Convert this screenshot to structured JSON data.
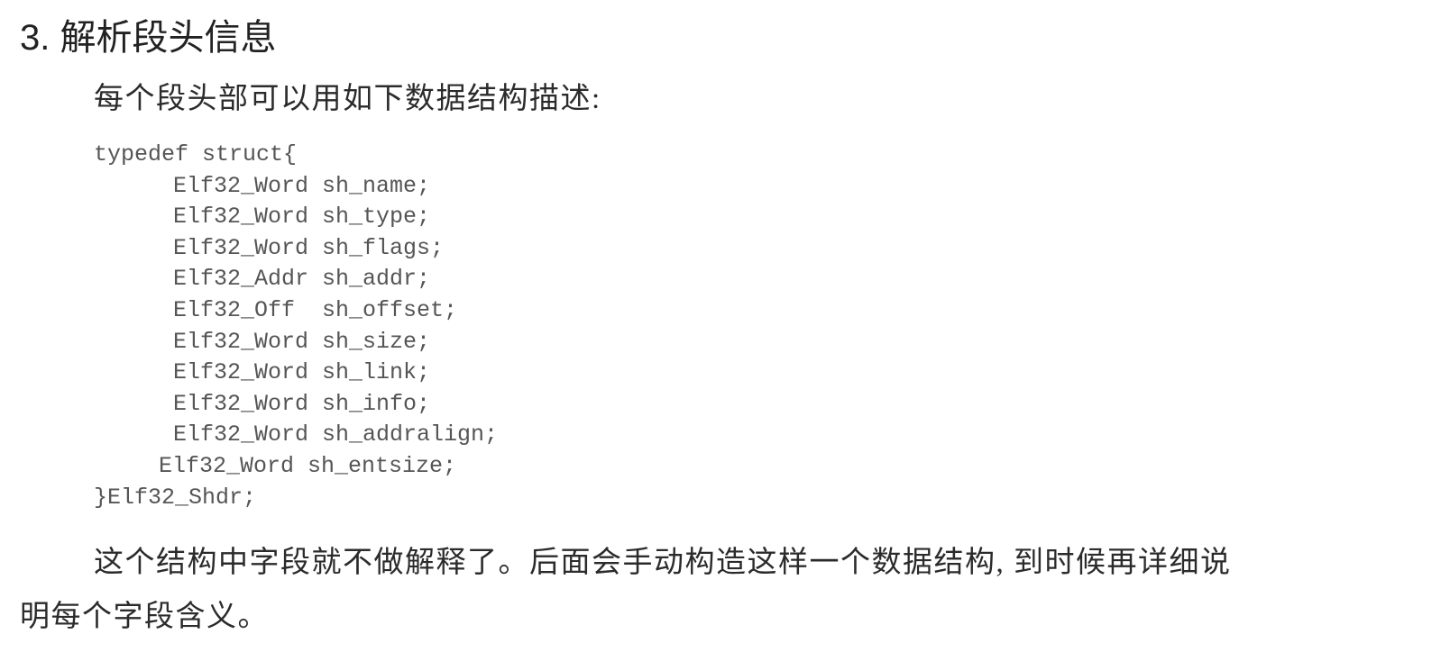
{
  "section": {
    "heading": "3. 解析段头信息",
    "intro": "每个段头部可以用如下数据结构描述:",
    "code": {
      "open": "typedef struct{",
      "fields": [
        "Elf32_Word sh_name;",
        "Elf32_Word sh_type;",
        "Elf32_Word sh_flags;",
        "Elf32_Addr sh_addr;",
        "Elf32_Off  sh_offset;",
        "Elf32_Word sh_size;",
        "Elf32_Word sh_link;",
        "Elf32_Word sh_info;",
        "Elf32_Word sh_addralign;",
        "Elf32_Word sh_entsize;"
      ],
      "close": "}Elf32_Shdr;"
    },
    "closing_line_1": "这个结构中字段就不做解释了。后面会手动构造这样一个数据结构, 到时候再详细说",
    "closing_line_2": "明每个字段含义。"
  }
}
